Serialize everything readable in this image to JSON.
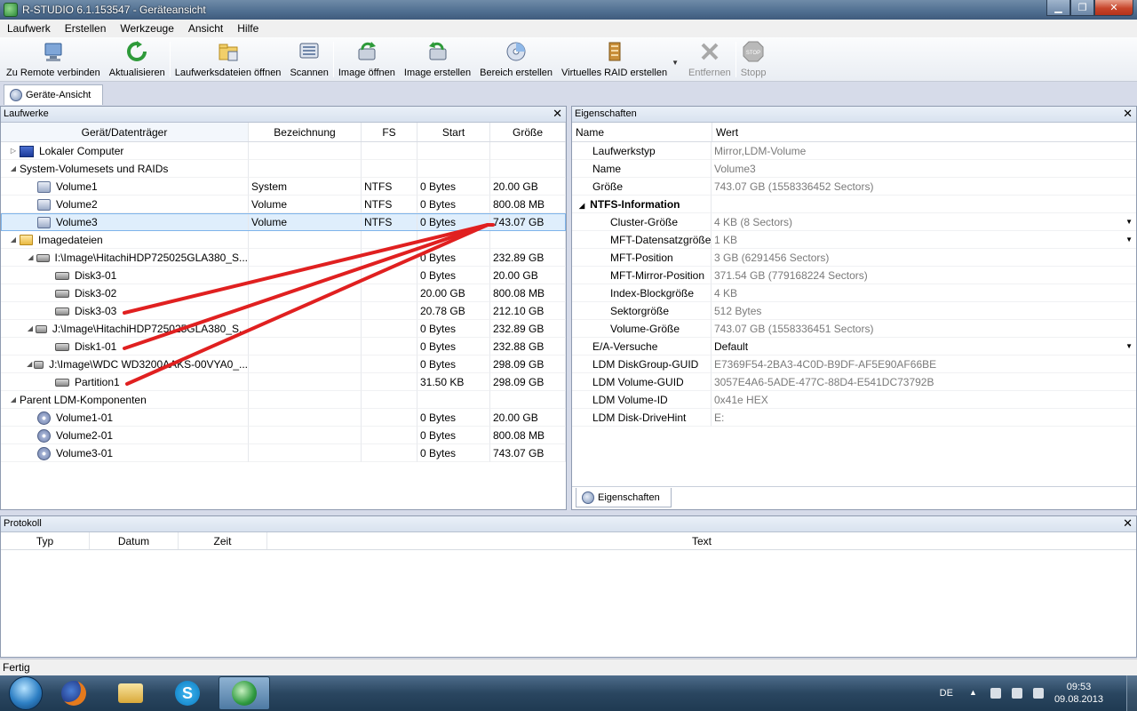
{
  "window": {
    "title": "R-STUDIO 6.1.153547 - Geräteansicht",
    "buttons": {
      "minimize": "▁",
      "maximize": "❐",
      "close": "✕"
    }
  },
  "menu": [
    "Laufwerk",
    "Erstellen",
    "Werkzeuge",
    "Ansicht",
    "Hilfe"
  ],
  "toolbar": {
    "remote_connect": "Zu Remote verbinden",
    "refresh": "Aktualisieren",
    "open_drive_files": "Laufwerksdateien öffnen",
    "scan": "Scannen",
    "open_image": "Image öffnen",
    "create_image": "Image erstellen",
    "create_region": "Bereich erstellen",
    "create_virtual_raid": "Virtuelles RAID erstellen",
    "remove": "Entfernen",
    "stop": "Stopp"
  },
  "tab": {
    "label": "Geräte-Ansicht"
  },
  "drives_panel": {
    "title": "Laufwerke",
    "columns": [
      "Gerät/Datenträger",
      "Bezeichnung",
      "FS",
      "Start",
      "Größe"
    ],
    "rows": [
      {
        "device": "Lokaler Computer",
        "label": "",
        "fs": "",
        "start": "",
        "size": ""
      },
      {
        "device": "System-Volumesets und RAIDs",
        "label": "",
        "fs": "",
        "start": "",
        "size": ""
      },
      {
        "device": "Volume1",
        "label": "System",
        "fs": "NTFS",
        "start": "0 Bytes",
        "size": "20.00 GB"
      },
      {
        "device": "Volume2",
        "label": "Volume",
        "fs": "NTFS",
        "start": "0 Bytes",
        "size": "800.08 MB"
      },
      {
        "device": "Volume3",
        "label": "Volume",
        "fs": "NTFS",
        "start": "0 Bytes",
        "size": "743.07 GB"
      },
      {
        "device": "Imagedateien",
        "label": "",
        "fs": "",
        "start": "",
        "size": ""
      },
      {
        "device": "I:\\Image\\HitachiHDP725025GLA380_S...",
        "label": "",
        "fs": "",
        "start": "0 Bytes",
        "size": "232.89 GB"
      },
      {
        "device": "Disk3-01",
        "label": "",
        "fs": "",
        "start": "0 Bytes",
        "size": "20.00 GB"
      },
      {
        "device": "Disk3-02",
        "label": "",
        "fs": "",
        "start": "20.00 GB",
        "size": "800.08 MB"
      },
      {
        "device": "Disk3-03",
        "label": "",
        "fs": "",
        "start": "20.78 GB",
        "size": "212.10 GB"
      },
      {
        "device": "J:\\Image\\HitachiHDP725025GLA380_S...",
        "label": "",
        "fs": "",
        "start": "0 Bytes",
        "size": "232.89 GB"
      },
      {
        "device": "Disk1-01",
        "label": "",
        "fs": "",
        "start": "0 Bytes",
        "size": "232.88 GB"
      },
      {
        "device": "J:\\Image\\WDC WD3200AAKS-00VYA0_...",
        "label": "",
        "fs": "",
        "start": "0 Bytes",
        "size": "298.09 GB"
      },
      {
        "device": "Partition1",
        "label": "",
        "fs": "",
        "start": "31.50 KB",
        "size": "298.09 GB"
      },
      {
        "device": "Parent LDM-Komponenten",
        "label": "",
        "fs": "",
        "start": "",
        "size": ""
      },
      {
        "device": "Volume1-01",
        "label": "",
        "fs": "",
        "start": "0 Bytes",
        "size": "20.00 GB"
      },
      {
        "device": "Volume2-01",
        "label": "",
        "fs": "",
        "start": "0 Bytes",
        "size": "800.08 MB"
      },
      {
        "device": "Volume3-01",
        "label": "",
        "fs": "",
        "start": "0 Bytes",
        "size": "743.07 GB"
      }
    ]
  },
  "properties_panel": {
    "title": "Eigenschaften",
    "columns": [
      "Name",
      "Wert"
    ],
    "rows": [
      {
        "name": "Laufwerkstyp",
        "value": "Mirror,LDM-Volume"
      },
      {
        "name": "Name",
        "value": "Volume3"
      },
      {
        "name": "Größe",
        "value": "743.07 GB (1558336452 Sectors)"
      },
      {
        "name": "NTFS-Information",
        "value": ""
      },
      {
        "name": "Cluster-Größe",
        "value": "4 KB (8 Sectors)"
      },
      {
        "name": "MFT-Datensatzgröße",
        "value": "1 KB"
      },
      {
        "name": "MFT-Position",
        "value": "3 GB (6291456 Sectors)"
      },
      {
        "name": "MFT-Mirror-Position",
        "value": "371.54 GB (779168224 Sectors)"
      },
      {
        "name": "Index-Blockgröße",
        "value": "4 KB"
      },
      {
        "name": "Sektorgröße",
        "value": "512 Bytes"
      },
      {
        "name": "Volume-Größe",
        "value": "743.07 GB (1558336451 Sectors)"
      },
      {
        "name": "E/A-Versuche",
        "value": "Default"
      },
      {
        "name": "LDM DiskGroup-GUID",
        "value": "E7369F54-2BA3-4C0D-B9DF-AF5E90AF66BE"
      },
      {
        "name": "LDM Volume-GUID",
        "value": "3057E4A6-5ADE-477C-88D4-E541DC73792B"
      },
      {
        "name": "LDM Volume-ID",
        "value": "0x41e HEX"
      },
      {
        "name": "LDM Disk-DriveHint",
        "value": "E:"
      }
    ],
    "bottom_tab": "Eigenschaften"
  },
  "log_panel": {
    "title": "Protokoll",
    "columns": [
      "Typ",
      "Datum",
      "Zeit",
      "Text"
    ]
  },
  "status": {
    "text": "Fertig"
  },
  "taskbar": {
    "language": "DE",
    "time": "09:53",
    "date": "09.08.2013"
  },
  "colors": {
    "annotation": "#e02020",
    "selection": "#dfeefc"
  }
}
